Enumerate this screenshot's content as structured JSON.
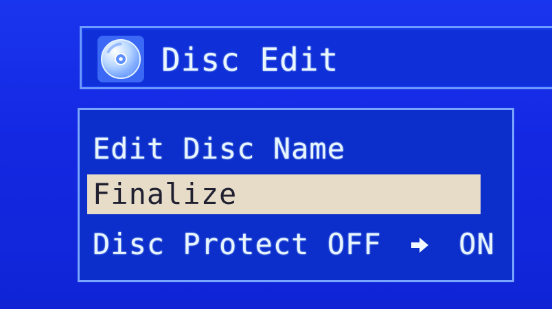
{
  "header": {
    "title": "Disc Edit",
    "icon": "disc-icon"
  },
  "menu": {
    "items": [
      {
        "label": "Edit Disc Name",
        "selected": false
      },
      {
        "label": "Finalize",
        "selected": true
      },
      {
        "label_prefix": "Disc Protect OFF",
        "label_suffix": "ON",
        "icon": "arrow-right-icon",
        "selected": false
      }
    ]
  },
  "colors": {
    "background": "#1428e0",
    "highlight": "#e6dcc8",
    "text": "#e8f5ff",
    "border": "#79a5ff"
  }
}
